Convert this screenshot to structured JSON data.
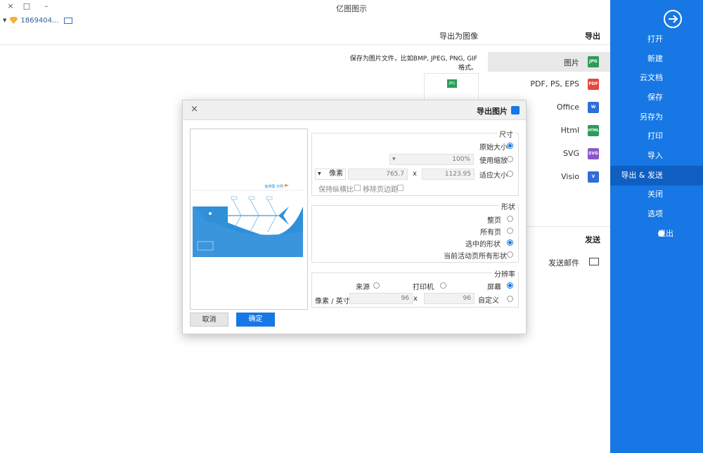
{
  "window": {
    "title": "亿图图示",
    "close": "×",
    "restore": "□",
    "minimize": "–"
  },
  "user": {
    "id": "186940​4...",
    "vip_icon": "vip-gem"
  },
  "panel": {
    "heading": "导出为图像",
    "description": "保存为图片文件，比如BMP, JPEG, PNG, GIF格式。",
    "jpg_badge": "JPG"
  },
  "sidebar": {
    "items": [
      "打开",
      "新建",
      "云文档",
      "保存",
      "另存为",
      "打印",
      "导入",
      "导出 & 发送",
      "关闭",
      "选项",
      "退出"
    ],
    "active_index": 7
  },
  "export": {
    "section_title": "导出",
    "formats": [
      {
        "label": "图片",
        "badge": "JPG",
        "color": "#2e9b5a"
      },
      {
        "label": "PDF, PS, EPS",
        "badge": "PDF",
        "color": "#e5483d"
      },
      {
        "label": "Office",
        "badge": "W",
        "color": "#2d6ed8"
      },
      {
        "label": "Html",
        "badge": "HTML",
        "color": "#2e9b5a"
      },
      {
        "label": "SVG",
        "badge": "SVG",
        "color": "#8a56c9"
      },
      {
        "label": "Visio",
        "badge": "V",
        "color": "#2d6ed8"
      }
    ],
    "send_title": "发送",
    "send_items": [
      {
        "label": "发送邮件"
      }
    ]
  },
  "dialog": {
    "title": "导出图片",
    "close": "×",
    "size": {
      "title": "尺寸",
      "options": [
        "原始大小",
        "使用缩放",
        "适应大小"
      ],
      "selected": 0,
      "zoom_value": "100%",
      "width": "1123.95",
      "x": "x",
      "height": "765.7",
      "unit": "像素",
      "remove_margin": "移除页边距",
      "keep_ratio": "保持纵横比"
    },
    "shape": {
      "title": "形状",
      "options": [
        "整页",
        "所有页",
        "选中的形状",
        "当前活动页所有形状"
      ],
      "selected": 2
    },
    "resolution": {
      "title": "分辨率",
      "options": [
        "屏幕",
        "打印机",
        "来源"
      ],
      "selected": 0,
      "custom": "自定义",
      "dpi_x": "96",
      "x": "x",
      "dpi_y": "96",
      "unit": "像素 / 英寸"
    },
    "ok": "确定",
    "cancel": "取消"
  },
  "preview": {
    "title": "鱼骨图 示例"
  }
}
